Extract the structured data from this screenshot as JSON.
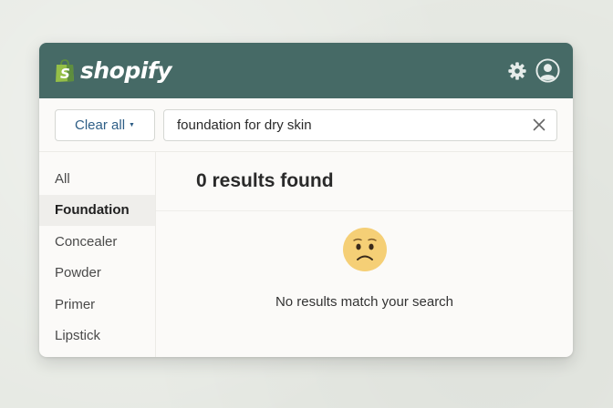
{
  "header": {
    "brand": "shopify",
    "icons": [
      "shopify-bag-icon",
      "gear-icon",
      "account-icon"
    ]
  },
  "search": {
    "clear_label": "Clear all",
    "query": "foundation for dry skin"
  },
  "sidebar": {
    "items": [
      {
        "label": "All",
        "active": false
      },
      {
        "label": "Foundation",
        "active": true
      },
      {
        "label": "Concealer",
        "active": false
      },
      {
        "label": "Powder",
        "active": false
      },
      {
        "label": "Primer",
        "active": false
      },
      {
        "label": "Lipstick",
        "active": false
      }
    ]
  },
  "results": {
    "count_text": "0 results found",
    "empty_message": "No results match your search",
    "empty_icon": "sad-face-icon"
  },
  "colors": {
    "header": "#466a66",
    "brand_green": "#95bf47",
    "link_blue": "#2e5e86",
    "emoji_face": "#f5cf76"
  }
}
